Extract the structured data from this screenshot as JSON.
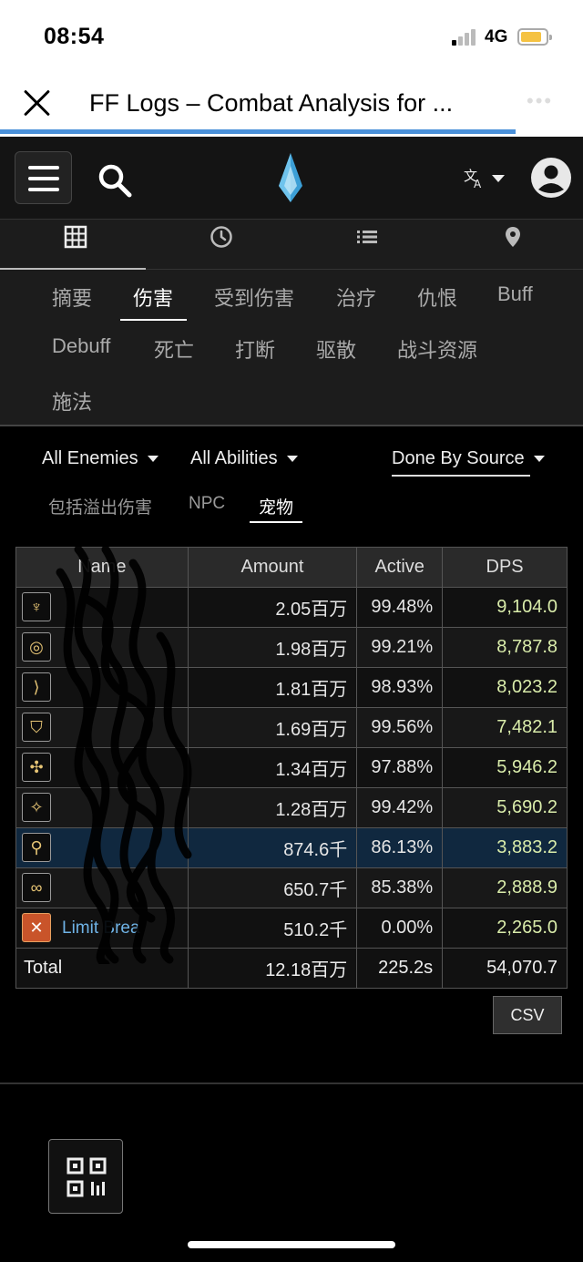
{
  "status": {
    "time": "08:54",
    "network": "4G"
  },
  "browser": {
    "title": "FF Logs – Combat Analysis for ..."
  },
  "categories": [
    "摘要",
    "伤害",
    "受到伤害",
    "治疗",
    "仇恨",
    "Buff",
    "Debuff",
    "死亡",
    "打断",
    "驱散",
    "战斗资源",
    "施法"
  ],
  "filters": {
    "enemies": "All Enemies",
    "abilities": "All Abilities",
    "source": "Done By Source"
  },
  "options": [
    "包括溢出伤害",
    "NPC",
    "宠物"
  ],
  "table": {
    "headers": {
      "name": "Name",
      "amount": "Amount",
      "active": "Active",
      "dps": "DPS"
    },
    "rows": [
      {
        "icon": "dragoon-icon",
        "glyph": "♆",
        "name": "",
        "amount": "2.05百万",
        "active": "99.48%",
        "dps": "9,104.0"
      },
      {
        "icon": "summoner-icon",
        "glyph": "◎",
        "name": "",
        "amount": "1.98百万",
        "active": "99.21%",
        "dps": "8,787.8"
      },
      {
        "icon": "bard-icon",
        "glyph": "⟩",
        "name": "",
        "amount": "1.81百万",
        "active": "98.93%",
        "dps": "8,023.2"
      },
      {
        "icon": "paladin-icon",
        "glyph": "⛉",
        "name": "",
        "amount": "1.69百万",
        "active": "99.56%",
        "dps": "7,482.1"
      },
      {
        "icon": "dark-knight-icon",
        "glyph": "✣",
        "name": "",
        "amount": "1.34百万",
        "active": "97.88%",
        "dps": "5,946.2"
      },
      {
        "icon": "astrologian-icon",
        "glyph": "✧",
        "name": "",
        "amount": "1.28百万",
        "active": "99.42%",
        "dps": "5,690.2"
      },
      {
        "icon": "white-mage-icon",
        "glyph": "⚲",
        "name": "",
        "amount": "874.6千",
        "active": "86.13%",
        "dps": "3,883.2"
      },
      {
        "icon": "scholar-icon",
        "glyph": "∞",
        "name": "",
        "amount": "650.7千",
        "active": "85.38%",
        "dps": "2,888.9"
      },
      {
        "icon": "limit-break-icon",
        "glyph": "✕",
        "name": "Limit Brea",
        "amount": "510.2千",
        "active": "0.00%",
        "dps": "2,265.0"
      }
    ],
    "total": {
      "label": "Total",
      "amount": "12.18百万",
      "active": "225.2s",
      "dps": "54,070.7"
    }
  },
  "csv_label": "CSV"
}
